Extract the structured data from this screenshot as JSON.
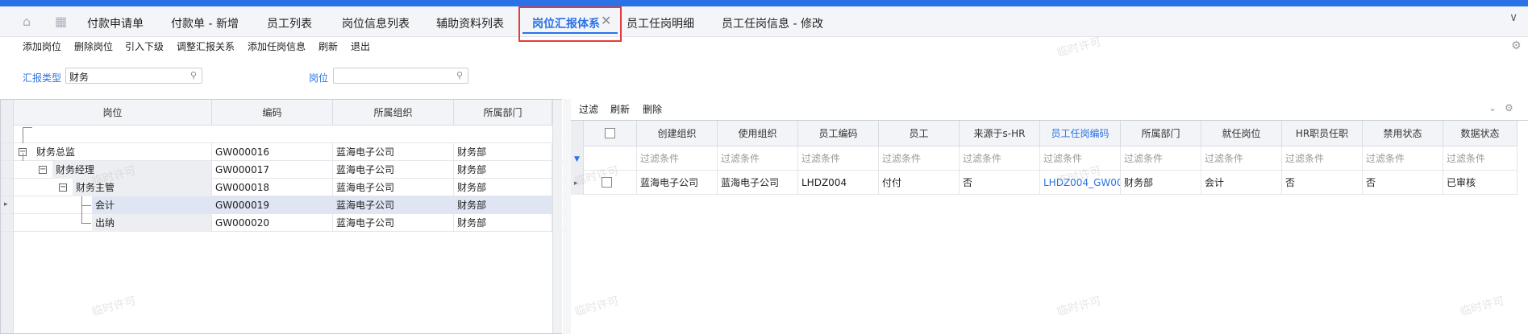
{
  "tabs": [
    {
      "label": "付款申请单"
    },
    {
      "label": "付款单 - 新增"
    },
    {
      "label": "员工列表"
    },
    {
      "label": "岗位信息列表"
    },
    {
      "label": "辅助资料列表"
    },
    {
      "label": "岗位汇报体系"
    },
    {
      "label": "员工任岗明细"
    },
    {
      "label": "员工任岗信息 - 修改"
    }
  ],
  "active_tab": "岗位汇报体系",
  "toolbar": [
    "添加岗位",
    "删除岗位",
    "引入下级",
    "调整汇报关系",
    "添加任岗信息",
    "刷新",
    "退出"
  ],
  "filters": {
    "report_type_label": "汇报类型",
    "report_type_value": "财务",
    "position_label": "岗位",
    "position_value": ""
  },
  "left_table": {
    "headers": [
      "岗位",
      "编码",
      "所属组织",
      "所属部门"
    ],
    "rows": [
      {
        "name": "财务总监",
        "code": "GW000016",
        "org": "蓝海电子公司",
        "dept": "财务部"
      },
      {
        "name": "财务经理",
        "code": "GW000017",
        "org": "蓝海电子公司",
        "dept": "财务部"
      },
      {
        "name": "财务主管",
        "code": "GW000018",
        "org": "蓝海电子公司",
        "dept": "财务部"
      },
      {
        "name": "会计",
        "code": "GW000019",
        "org": "蓝海电子公司",
        "dept": "财务部"
      },
      {
        "name": "出纳",
        "code": "GW000020",
        "org": "蓝海电子公司",
        "dept": "财务部"
      }
    ]
  },
  "right_toolbar": [
    "过滤",
    "刷新",
    "删除"
  ],
  "right_table": {
    "headers": [
      "创建组织",
      "使用组织",
      "员工编码",
      "员工",
      "来源于s-HR",
      "员工任岗编码",
      "所属部门",
      "就任岗位",
      "HR职员任职",
      "禁用状态",
      "数据状态"
    ],
    "filter_placeholder": "过滤条件",
    "row": [
      "蓝海电子公司",
      "蓝海电子公司",
      "LHDZ004",
      "付付",
      "否",
      "LHDZ004_GW00",
      "财务部",
      "会计",
      "否",
      "否",
      "已审核"
    ]
  },
  "watermark": "临时许可",
  "colors": {
    "accent": "#2a72e6",
    "highlight_box": "#e63a3a",
    "selected_row": "#dfe5f3"
  }
}
